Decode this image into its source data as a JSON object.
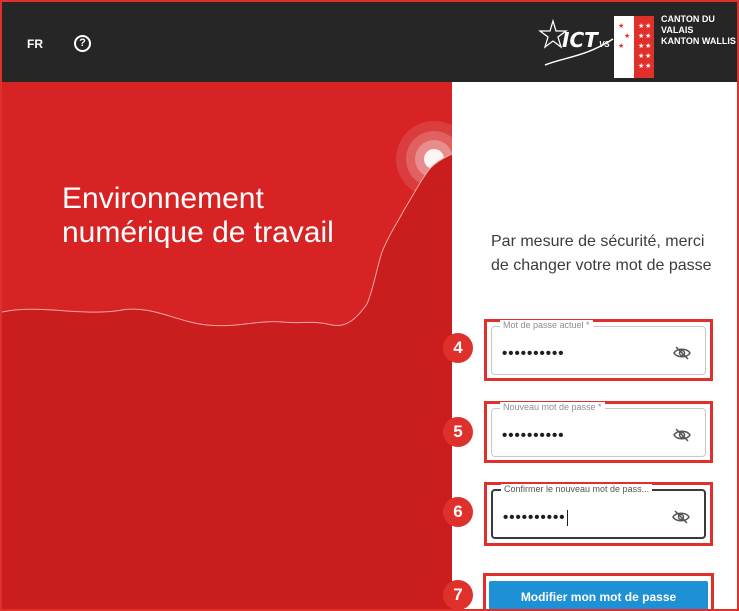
{
  "header": {
    "language": "FR",
    "help_icon": "help-circle-icon",
    "logo_ict_text": "ICT",
    "logo_ict_sub": "VS",
    "canton_line1": "CANTON DU VALAIS",
    "canton_line2": "KANTON WALLIS"
  },
  "hero": {
    "title_line1": "Environnement",
    "title_line2": "numérique de travail"
  },
  "form": {
    "intro": "Par mesure de sécurité, merci de changer votre mot de passe",
    "current_password": {
      "label": "Mot de passe actuel *",
      "value": "••••••••••",
      "badge": "4",
      "toggle_icon": "eye-off-icon"
    },
    "new_password": {
      "label": "Nouveau mot de passe *",
      "value": "••••••••••",
      "badge": "5",
      "toggle_icon": "eye-off-icon"
    },
    "confirm_password": {
      "label": "Confirmer le nouveau mot de pass...",
      "value": "••••••••••",
      "badge": "6",
      "toggle_icon": "eye-off-icon"
    },
    "submit": {
      "label": "Modifier mon mot de passe",
      "badge": "7"
    }
  },
  "colors": {
    "brand_red": "#d72324",
    "annotation_red": "#e0302b",
    "topbar": "#262626",
    "button_blue": "#1e90d6"
  }
}
